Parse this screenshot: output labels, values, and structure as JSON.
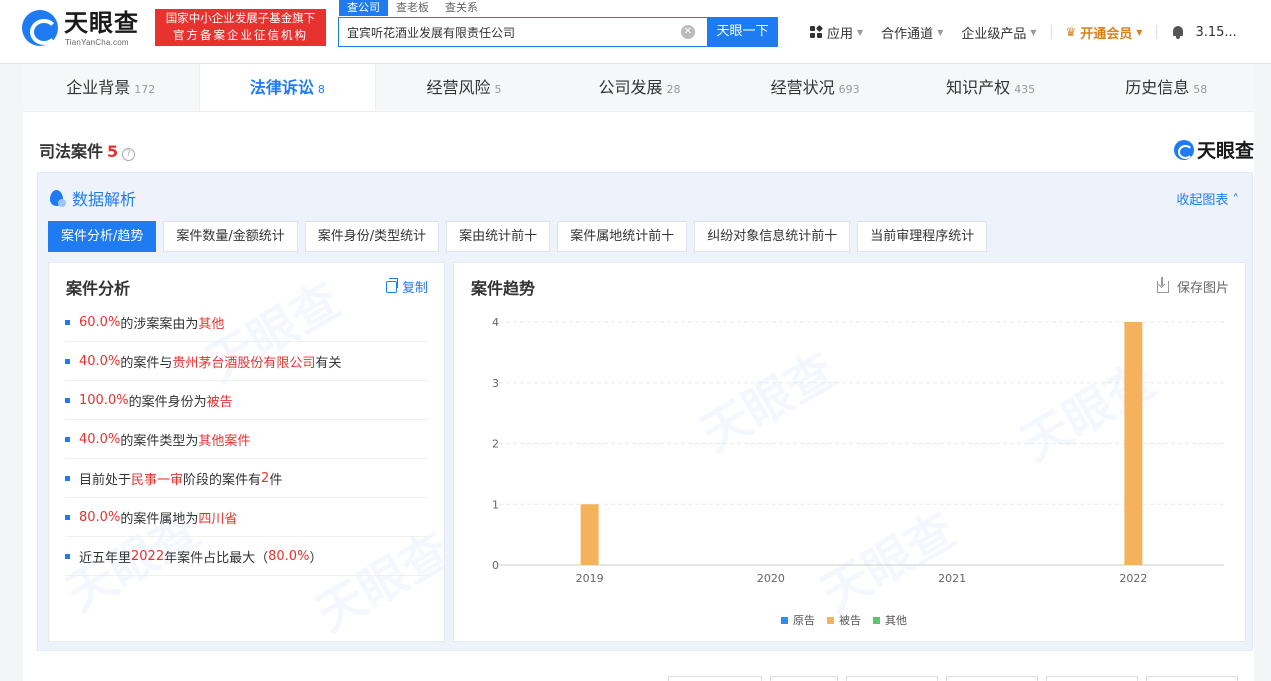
{
  "header": {
    "logo_name": "天眼查",
    "logo_url": "TianYanCha.com",
    "gov_badge_line1": "国家中小企业发展子基金旗下",
    "gov_badge_line2": "官方备案企业征信机构",
    "search_tabs": [
      "查公司",
      "查老板",
      "查关系"
    ],
    "search_value": "宜宾听花酒业发展有限责任公司",
    "search_button": "天眼一下",
    "nav": {
      "apps": "应用",
      "channels": "合作通道",
      "enterprise": "企业级产品",
      "vip": "开通会员",
      "user": "3.15..."
    }
  },
  "category_tabs": [
    {
      "label": "企业背景",
      "count": "172"
    },
    {
      "label": "法律诉讼",
      "count": "8"
    },
    {
      "label": "经营风险",
      "count": "5"
    },
    {
      "label": "公司发展",
      "count": "28"
    },
    {
      "label": "经营状况",
      "count": "693"
    },
    {
      "label": "知识产权",
      "count": "435"
    },
    {
      "label": "历史信息",
      "count": "58"
    }
  ],
  "section": {
    "title": "司法案件",
    "count": "5",
    "help": "?",
    "brand": "天眼查"
  },
  "analysis": {
    "title": "数据解析",
    "collapse": "收起图表",
    "sub_tabs": [
      "案件分析/趋势",
      "案件数量/金额统计",
      "案件身份/类型统计",
      "案由统计前十",
      "案件属地统计前十",
      "纠纷对象信息统计前十",
      "当前审理程序统计"
    ],
    "left": {
      "title": "案件分析",
      "copy": "复制",
      "items": [
        [
          {
            "t": "60.0%",
            "h": true
          },
          {
            "t": "的涉案案由为",
            "h": false
          },
          {
            "t": "其他",
            "h": true
          }
        ],
        [
          {
            "t": "40.0%",
            "h": true
          },
          {
            "t": "的案件与",
            "h": false
          },
          {
            "t": "贵州茅台酒股份有限公司",
            "h": true
          },
          {
            "t": "有关",
            "h": false
          }
        ],
        [
          {
            "t": "100.0%",
            "h": true
          },
          {
            "t": "的案件身份为",
            "h": false
          },
          {
            "t": "被告",
            "h": true
          }
        ],
        [
          {
            "t": "40.0%",
            "h": true
          },
          {
            "t": "的案件类型为",
            "h": false
          },
          {
            "t": "其他案件",
            "h": true
          }
        ],
        [
          {
            "t": "目前处于",
            "h": false
          },
          {
            "t": "民事一审",
            "h": true
          },
          {
            "t": "阶段的案件有",
            "h": false
          },
          {
            "t": "2",
            "h": true
          },
          {
            "t": "件",
            "h": false
          }
        ],
        [
          {
            "t": "80.0%",
            "h": true
          },
          {
            "t": "的案件属地为",
            "h": false
          },
          {
            "t": "四川省",
            "h": true
          }
        ],
        [
          {
            "t": "近五年里",
            "h": false
          },
          {
            "t": "2022",
            "h": true
          },
          {
            "t": "年案件占比最大（",
            "h": false
          },
          {
            "t": "80.0%",
            "h": true
          },
          {
            "t": "）",
            "h": false
          }
        ]
      ]
    },
    "right": {
      "title": "案件趋势",
      "save": "保存图片"
    }
  },
  "chart_data": {
    "type": "bar",
    "title": "案件趋势",
    "categories": [
      "2019",
      "2020",
      "2021",
      "2022"
    ],
    "series": [
      {
        "name": "原告",
        "color": "#2f8cf5",
        "values": [
          0,
          0,
          0,
          0
        ]
      },
      {
        "name": "被告",
        "color": "#f5b25c",
        "values": [
          1,
          0,
          0,
          4
        ]
      },
      {
        "name": "其他",
        "color": "#5ec46d",
        "values": [
          0,
          0,
          0,
          0
        ]
      }
    ],
    "ylim": [
      0,
      4
    ],
    "yticks": [
      "0",
      "1",
      "2",
      "3",
      "4"
    ],
    "grid": true,
    "legend": "bottom-center"
  },
  "watermark": "天眼查",
  "colors": {
    "accent": "#1f7bf2",
    "highlight": "#e8322f",
    "vip": "#d9821b"
  }
}
